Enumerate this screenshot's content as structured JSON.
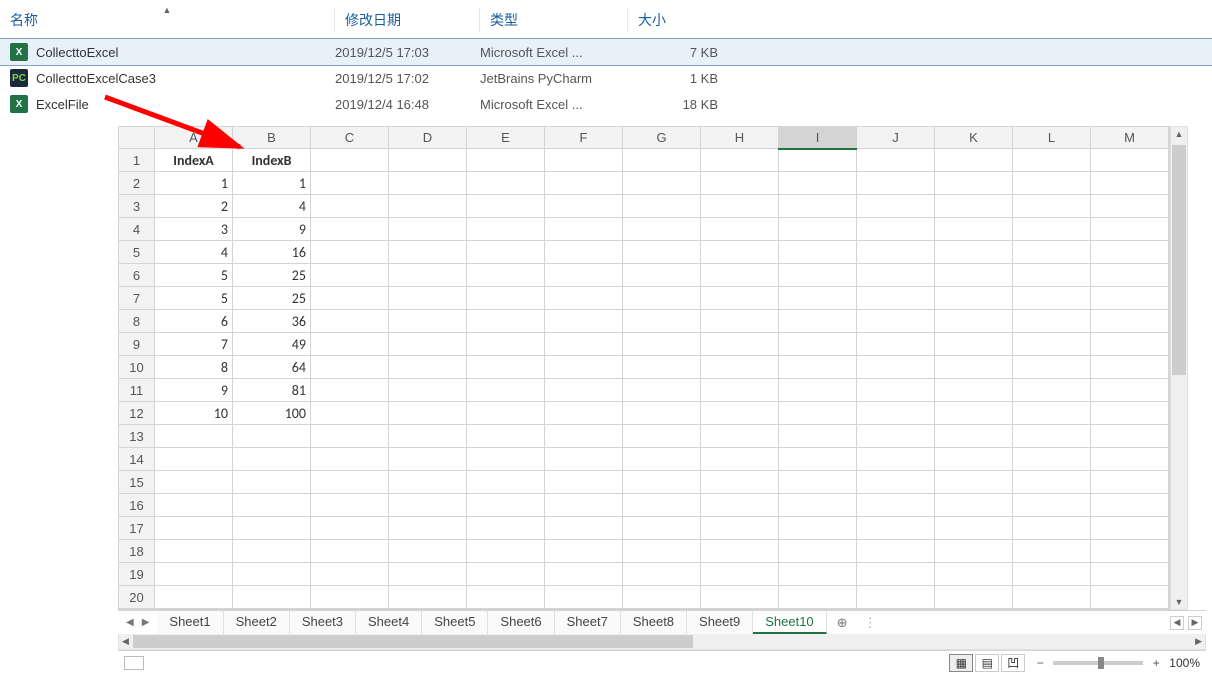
{
  "explorer": {
    "columns": {
      "name": "名称",
      "date": "修改日期",
      "type": "类型",
      "size": "大小"
    },
    "files": [
      {
        "name": "CollecttoExcel",
        "date": "2019/12/5 17:03",
        "type": "Microsoft Excel ...",
        "size": "7 KB",
        "icon": "xlsx",
        "selected": true
      },
      {
        "name": "CollecttoExcelCase3",
        "date": "2019/12/5 17:02",
        "type": "JetBrains PyCharm",
        "size": "1 KB",
        "icon": "py",
        "selected": false
      },
      {
        "name": "ExcelFile",
        "date": "2019/12/4 16:48",
        "type": "Microsoft Excel ...",
        "size": "18 KB",
        "icon": "xlsx",
        "selected": false
      }
    ]
  },
  "spreadsheet": {
    "columns": [
      "A",
      "B",
      "C",
      "D",
      "E",
      "F",
      "G",
      "H",
      "I",
      "J",
      "K",
      "L",
      "M"
    ],
    "selected_column": "I",
    "rows": [
      1,
      2,
      3,
      4,
      5,
      6,
      7,
      8,
      9,
      10,
      11,
      12,
      13,
      14,
      15,
      16,
      17,
      18,
      19,
      20
    ],
    "header_row": [
      "IndexA",
      "IndexB"
    ],
    "data_rows": [
      [
        "1",
        "1"
      ],
      [
        "2",
        "4"
      ],
      [
        "3",
        "9"
      ],
      [
        "4",
        "16"
      ],
      [
        "5",
        "25"
      ],
      [
        "5",
        "25"
      ],
      [
        "6",
        "36"
      ],
      [
        "7",
        "49"
      ],
      [
        "8",
        "64"
      ],
      [
        "9",
        "81"
      ],
      [
        "10",
        "100"
      ]
    ],
    "tabs": [
      "Sheet1",
      "Sheet2",
      "Sheet3",
      "Sheet4",
      "Sheet5",
      "Sheet6",
      "Sheet7",
      "Sheet8",
      "Sheet9",
      "Sheet10"
    ],
    "active_tab": "Sheet10",
    "zoom": "100%"
  }
}
